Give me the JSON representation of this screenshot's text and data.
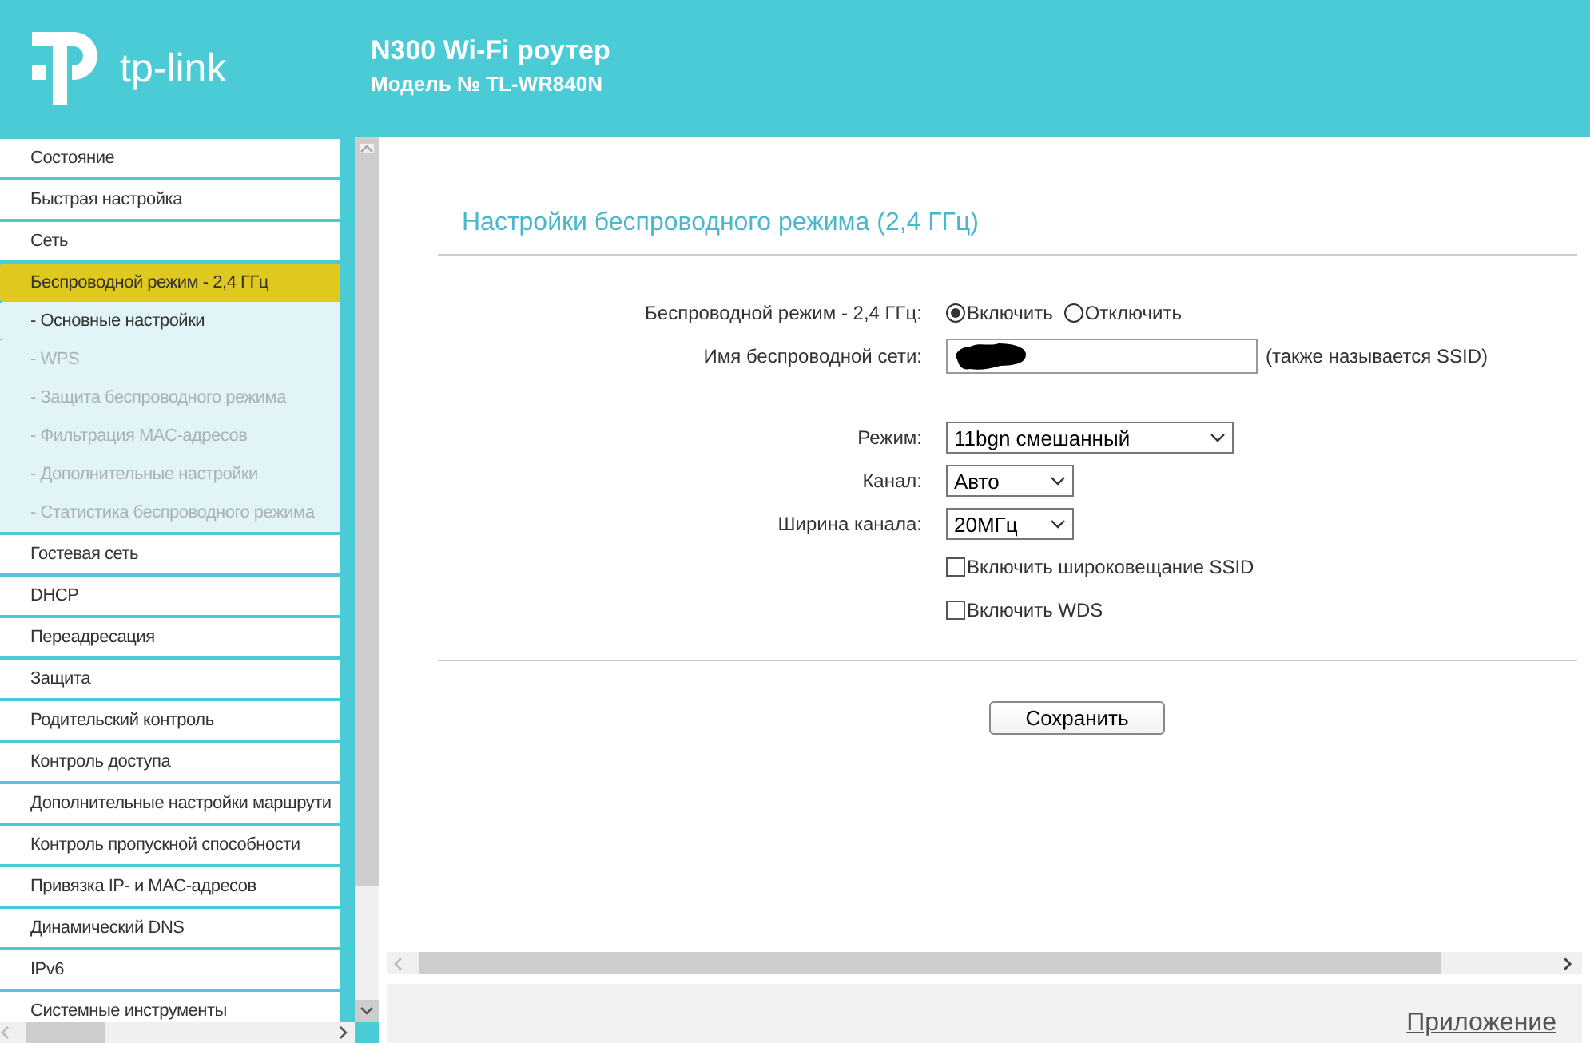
{
  "header": {
    "logo_text": "tp-link",
    "title": "N300 Wi-Fi роутер",
    "model": "Модель № TL-WR840N"
  },
  "sidebar": {
    "items": [
      {
        "label": "Состояние",
        "kind": "main",
        "selected": false
      },
      {
        "label": "Быстрая настройка",
        "kind": "main",
        "selected": false
      },
      {
        "label": "Сеть",
        "kind": "main",
        "selected": false
      },
      {
        "label": "Беспроводной режим - 2,4 ГГц",
        "kind": "main",
        "selected": true
      },
      {
        "label": "- Основные настройки",
        "kind": "sub",
        "selected": true
      },
      {
        "label": "- WPS",
        "kind": "sub",
        "selected": false
      },
      {
        "label": "- Защита беспроводного режима",
        "kind": "sub",
        "selected": false
      },
      {
        "label": "- Фильтрация MAC-адресов",
        "kind": "sub",
        "selected": false
      },
      {
        "label": "- Дополнительные настройки",
        "kind": "sub",
        "selected": false
      },
      {
        "label": "- Статистика беспроводного режима",
        "kind": "sub",
        "selected": false
      },
      {
        "label": "Гостевая сеть",
        "kind": "main",
        "selected": false
      },
      {
        "label": "DHCP",
        "kind": "main",
        "selected": false
      },
      {
        "label": "Переадресация",
        "kind": "main",
        "selected": false
      },
      {
        "label": "Защита",
        "kind": "main",
        "selected": false
      },
      {
        "label": "Родительский контроль",
        "kind": "main",
        "selected": false
      },
      {
        "label": "Контроль доступа",
        "kind": "main",
        "selected": false
      },
      {
        "label": "Дополнительные настройки маршрути",
        "kind": "main",
        "selected": false
      },
      {
        "label": "Контроль пропускной способности",
        "kind": "main",
        "selected": false
      },
      {
        "label": "Привязка IP- и MAC-адресов",
        "kind": "main",
        "selected": false
      },
      {
        "label": "Динамический DNS",
        "kind": "main",
        "selected": false
      },
      {
        "label": "IPv6",
        "kind": "main",
        "selected": false
      },
      {
        "label": "Системные инструменты",
        "kind": "main",
        "selected": false
      }
    ]
  },
  "main": {
    "title": "Настройки беспроводного режима (2,4 ГГц)",
    "fields": [
      {
        "kind": "radio",
        "label": "Беспроводной режим - 2,4 ГГц:",
        "options": [
          {
            "label": "Включить",
            "selected": true
          },
          {
            "label": "Отключить",
            "selected": false
          }
        ]
      },
      {
        "kind": "text",
        "label": "Имя беспроводной сети:",
        "redacted": true,
        "note": "(также называется SSID)"
      },
      {
        "kind": "spacer"
      },
      {
        "kind": "select",
        "label": "Режим:",
        "value": "11bgn смешанный"
      },
      {
        "kind": "select",
        "label": "Канал:",
        "value": "Авто"
      },
      {
        "kind": "select",
        "label": "Ширина канала:",
        "value": "20МГц"
      },
      {
        "kind": "checkbox",
        "label": "Включить широковещание SSID",
        "checked": false
      },
      {
        "kind": "checkbox",
        "label": "Включить WDS",
        "checked": false
      }
    ],
    "save_button": "Сохранить"
  },
  "footer": {
    "link": "Приложение"
  }
}
